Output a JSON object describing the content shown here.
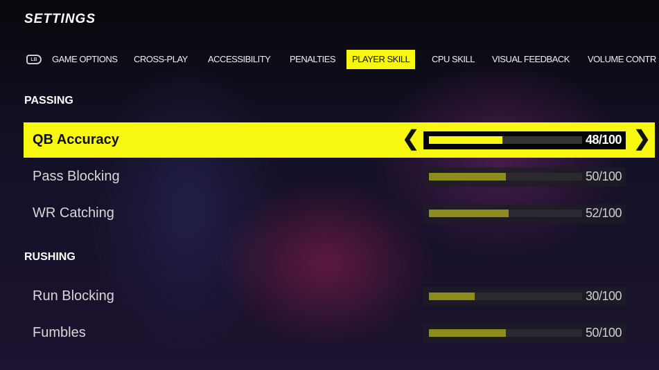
{
  "title": "SETTINGS",
  "tabs_bumper": "LB",
  "tabs": [
    {
      "label": "GAME OPTIONS"
    },
    {
      "label": "CROSS-PLAY"
    },
    {
      "label": "ACCESSIBILITY"
    },
    {
      "label": "PENALTIES"
    },
    {
      "label": "PLAYER SKILL",
      "active": true
    },
    {
      "label": "CPU SKILL"
    },
    {
      "label": "VISUAL FEEDBACK"
    },
    {
      "label": "VOLUME CONTR"
    }
  ],
  "sections": [
    {
      "header": "PASSING",
      "items": [
        {
          "label": "QB Accuracy",
          "value": 48,
          "display": "48/100",
          "selected": true
        },
        {
          "label": "Pass Blocking",
          "value": 50,
          "display": "50/100"
        },
        {
          "label": "WR Catching",
          "value": 52,
          "display": "52/100"
        }
      ]
    },
    {
      "header": "RUSHING",
      "items": [
        {
          "label": "Run Blocking",
          "value": 30,
          "display": "30/100"
        },
        {
          "label": "Fumbles",
          "value": 50,
          "display": "50/100"
        }
      ]
    }
  ],
  "colors": {
    "accent": "#f7f711",
    "fill_inactive": "#8d8d1c"
  }
}
